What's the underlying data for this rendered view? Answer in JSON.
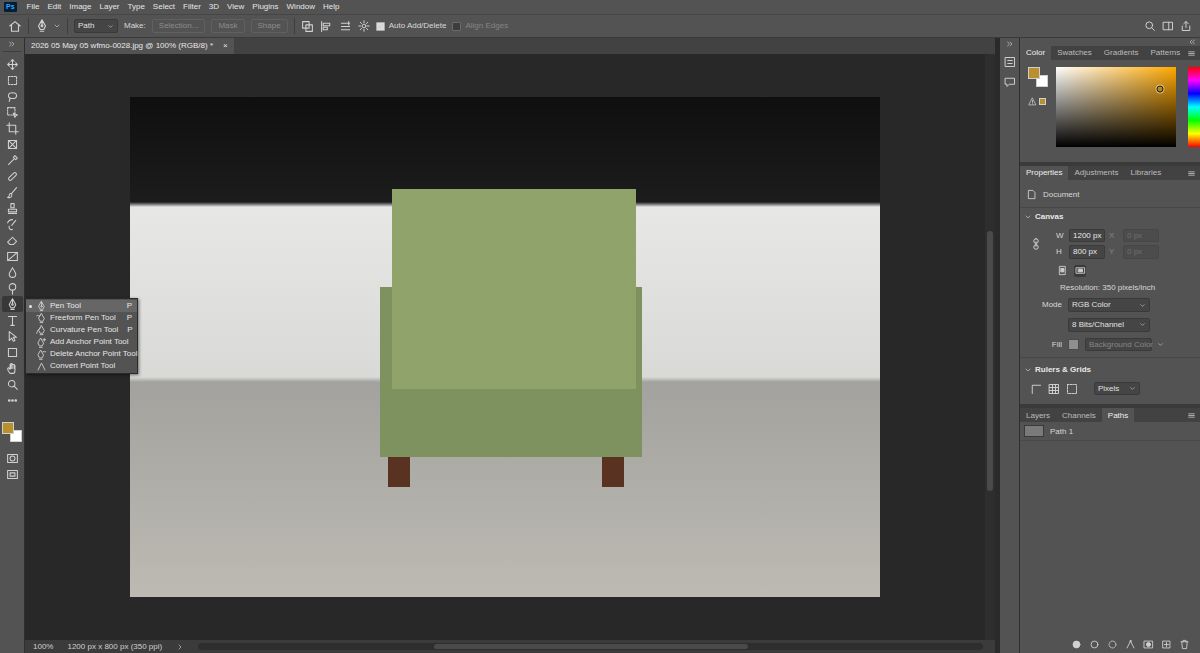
{
  "app": {
    "logo": "Ps"
  },
  "menu": [
    "File",
    "Edit",
    "Image",
    "Layer",
    "Type",
    "Select",
    "Filter",
    "3D",
    "View",
    "Plugins",
    "Window",
    "Help"
  ],
  "options_bar": {
    "mode": "Path",
    "make_label": "Make:",
    "make_buttons": [
      {
        "label": "Selection...",
        "disabled": true
      },
      {
        "label": "Mask",
        "disabled": true
      },
      {
        "label": "Shape",
        "disabled": true
      }
    ],
    "checkboxes": [
      {
        "label": "Auto Add/Delete",
        "checked": true,
        "disabled": false
      },
      {
        "label": "Align Edges",
        "checked": false,
        "disabled": true
      }
    ]
  },
  "document_tab": {
    "title": "2026 05 May 05 wfmo-0028.jpg @ 100% (RGB/8) *",
    "close": "×"
  },
  "colors": {
    "foreground": "#b8902c",
    "background": "#ffffff",
    "hue": "#ffa800",
    "saturation": 0.87,
    "brightness": 0.72
  },
  "toolbar": {
    "tools": [
      {
        "selected": false
      },
      {
        "selected": false
      },
      {
        "selected": false
      },
      {
        "selected": false
      },
      {
        "selected": false
      },
      {
        "selected": false
      },
      {
        "selected": false
      },
      {
        "selected": false
      },
      {
        "selected": false
      },
      {
        "selected": false
      },
      {
        "selected": false
      },
      {
        "selected": false
      },
      {
        "selected": false
      },
      {
        "selected": false
      },
      {
        "selected": false
      },
      {
        "selected": true
      },
      {
        "selected": false
      },
      {
        "selected": false
      },
      {
        "selected": false
      },
      {
        "selected": false
      },
      {
        "selected": false
      },
      {
        "selected": false
      }
    ]
  },
  "tool_flyout": {
    "items": [
      {
        "label": "Pen Tool",
        "shortcut": "P",
        "selected": true
      },
      {
        "label": "Freeform Pen Tool",
        "shortcut": "P",
        "selected": false
      },
      {
        "label": "Curvature Pen Tool",
        "shortcut": "P",
        "selected": false
      },
      {
        "label": "Add Anchor Point Tool",
        "selected": false
      },
      {
        "label": "Delete Anchor Point Tool",
        "selected": false
      },
      {
        "label": "Convert Point Tool",
        "selected": false
      }
    ]
  },
  "color_panel": {
    "tabs": [
      {
        "label": "Color",
        "selected": true
      },
      {
        "label": "Swatches",
        "selected": false
      },
      {
        "label": "Gradients",
        "selected": false
      },
      {
        "label": "Patterns",
        "selected": false
      }
    ]
  },
  "properties_panel": {
    "tabs": [
      {
        "label": "Properties",
        "selected": true
      },
      {
        "label": "Adjustments",
        "selected": false
      },
      {
        "label": "Libraries",
        "selected": false
      }
    ],
    "kind_label": "Document",
    "canvas": {
      "title": "Canvas",
      "expanded": true,
      "size_fields": [
        {
          "label": "W",
          "value": "1200 px",
          "disabled": false
        },
        {
          "label": "X",
          "value": "0 px",
          "disabled": true
        },
        {
          "label": "H",
          "value": "800 px",
          "disabled": false
        },
        {
          "label": "Y",
          "value": "0 px",
          "disabled": true
        }
      ],
      "orientations": [
        {
          "selected": false
        },
        {
          "selected": true
        }
      ],
      "resolution": "Resolution: 350 pixels/inch",
      "mode_label": "Mode",
      "mode": "RGB Color",
      "depth": "8 Bits/Channel",
      "fill_label": "Fill",
      "fill": "Background Color",
      "fill_disabled": true
    },
    "rulers": {
      "title": "Rulers & Grids",
      "expanded": true,
      "units": "Pixels"
    }
  },
  "layers_panel": {
    "tabs": [
      {
        "label": "Layers",
        "selected": false
      },
      {
        "label": "Channels",
        "selected": false
      },
      {
        "label": "Paths",
        "selected": true
      }
    ],
    "paths": [
      {
        "name": "Path 1",
        "selected": false
      }
    ]
  },
  "status_bar": {
    "zoom": "100%",
    "info": "1200 px x 800 px (350 ppi)"
  }
}
